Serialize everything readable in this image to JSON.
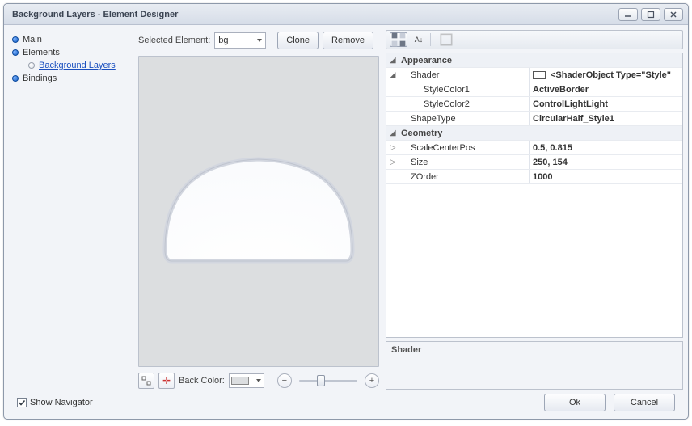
{
  "titlebar": {
    "title": "Background Layers - Element Designer"
  },
  "sidebar": {
    "items": [
      {
        "label": "Main"
      },
      {
        "label": "Elements"
      },
      {
        "label": "Background Layers"
      },
      {
        "label": "Bindings"
      }
    ]
  },
  "center": {
    "selected_label": "Selected Element:",
    "selected_value": "bg",
    "clone_label": "Clone",
    "remove_label": "Remove",
    "backcolor_label": "Back Color:"
  },
  "propgrid": {
    "categories": {
      "appearance": "Appearance",
      "geometry": "Geometry"
    },
    "rows": {
      "shader_name": "Shader",
      "shader_val": "<ShaderObject Type=\"Style\"",
      "stylecolor1_name": "StyleColor1",
      "stylecolor1_val": "ActiveBorder",
      "stylecolor2_name": "StyleColor2",
      "stylecolor2_val": "ControlLightLight",
      "shapetype_name": "ShapeType",
      "shapetype_val": "CircularHalf_Style1",
      "scalecenter_name": "ScaleCenterPos",
      "scalecenter_val": "0.5, 0.815",
      "size_name": "Size",
      "size_val": "250, 154",
      "zorder_name": "ZOrder",
      "zorder_val": "1000"
    },
    "desc_title": "Shader"
  },
  "sortbar": {
    "az": "A↓Z↓"
  },
  "footer": {
    "show_navigator": "Show Navigator",
    "ok": "Ok",
    "cancel": "Cancel"
  }
}
